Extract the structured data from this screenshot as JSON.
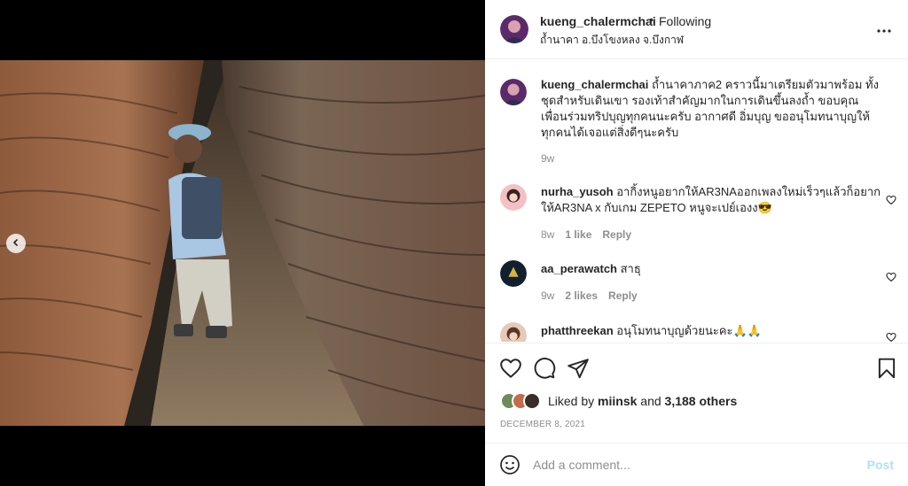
{
  "post": {
    "username": "kueng_chalermchai",
    "follow_status": "Following",
    "dot": "•",
    "location": "ถ้ำนาคา อ.บึงโขงหลง จ.บึงกาฬ",
    "caption": "ถ้ำนาคาภาค2 คราวนี้มาเตรียมตัวมาพร้อม ทั้งชุดสำหรับเดินเขา รองเท้าสำคัญมากในการเดินขึ้นลงถ้ำ ขอบคุณเพื่อนร่วมทริปบุญทุกคนนะครับ อากาศดี อิ่มบุญ ขออนุโมทนาบุญให้ทุกคนได้เจอแต่สิ่งดีๆนะครับ",
    "caption_time": "9w",
    "likes_prefix": "Liked by",
    "likes_user": "miinsk",
    "likes_and": "and",
    "likes_others": "3,188 others",
    "date": "DECEMBER 8, 2021"
  },
  "comments": [
    {
      "username": "nurha_yusoh",
      "text": "อากิ้งหนูอยากให้AR3NAออกเพลงใหม่เร็วๆแล้วก็อยากให้AR3NA x กับเกม ZEPETO หนูจะเปย์เองง😎",
      "time": "8w",
      "likes": "1 like",
      "reply": "Reply"
    },
    {
      "username": "aa_perawatch",
      "text": "สาธุ",
      "time": "9w",
      "likes": "2 likes",
      "reply": "Reply"
    },
    {
      "username": "phatthreekan",
      "text": "อนุโมทนาบุญด้วยนะคะ🙏🙏"
    }
  ],
  "add_comment": {
    "placeholder": "Add a comment...",
    "post_label": "Post"
  },
  "icons": {
    "prev": "chevron-left-icon",
    "more": "more-horizontal-icon",
    "like": "heart-icon",
    "comment": "comment-icon",
    "share": "paper-plane-icon",
    "save": "bookmark-icon",
    "emoji": "smiley-icon"
  },
  "colors": {
    "secondary_text": "#8e8e8e",
    "post_button": "#b2dffc",
    "divider": "#efefef"
  }
}
